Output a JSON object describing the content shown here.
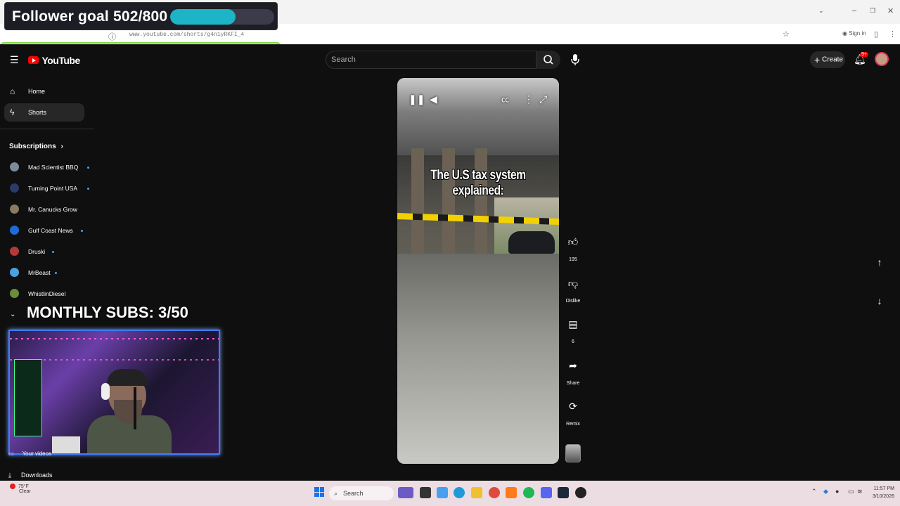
{
  "browser": {
    "url": "www.youtube.com/shorts/g4n1yRKFI_4",
    "sign_in": "Sign in"
  },
  "overlay": {
    "goal_text": "Follower goal 502/800",
    "goal_progress": 0.6275,
    "goal_color": "#1db4c8",
    "monthly_subs": "MONTHLY SUBS: 3/50"
  },
  "header": {
    "logo_text": "YouTube",
    "search_placeholder": "Search",
    "create_label": "Create",
    "notification_count": "9+"
  },
  "sidebar": {
    "nav": [
      {
        "label": "Home",
        "icon": "home-icon"
      },
      {
        "label": "Shorts",
        "icon": "shorts-icon"
      }
    ],
    "subscriptions_title": "Subscriptions",
    "subscriptions": [
      {
        "name": "Mad Scientist BBQ",
        "color": "#7d8a9b",
        "dot": true
      },
      {
        "name": "Turning Point USA",
        "color": "#2c3a66",
        "dot": true
      },
      {
        "name": "Mr. Canucks Grow",
        "color": "#8a7a60",
        "dot": false
      },
      {
        "name": "Gulf Coast News",
        "color": "#1e6bd6",
        "dot": true
      },
      {
        "name": "Druski",
        "color": "#b33a3a",
        "dot": true
      },
      {
        "name": "MrBeast",
        "color": "#4aa3df",
        "dot": true
      },
      {
        "name": "WhistlinDiesel",
        "color": "#6b8e3a",
        "dot": false
      }
    ],
    "bottom": [
      {
        "label": "Your videos",
        "icon": "video-icon"
      },
      {
        "label": "Downloads",
        "icon": "download-icon"
      }
    ]
  },
  "player": {
    "caption": "The U.S tax system explained:"
  },
  "actions": {
    "like_count": "195",
    "dislike_label": "Dislike",
    "comment_count": "6",
    "share_label": "Share",
    "remix_label": "Remix"
  },
  "taskbar": {
    "temperature": "75°F",
    "weather": "Clear",
    "search_label": "Search",
    "time": "11:57 PM",
    "date": "3/10/2026"
  }
}
